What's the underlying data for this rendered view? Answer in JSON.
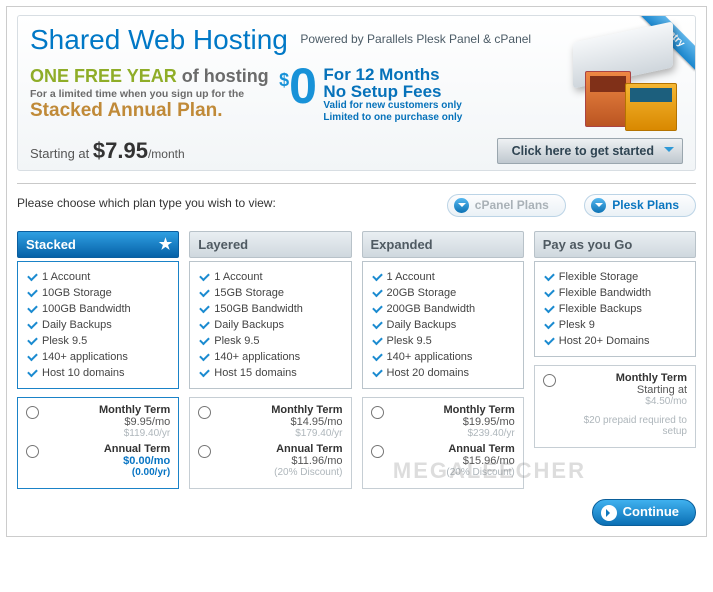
{
  "header": {
    "title": "Shared Web Hosting",
    "subtitle": "Powered by Parallels Plesk Panel & cPanel",
    "ribbon": "Entry"
  },
  "promo": {
    "line1_green": "ONE FREE YEAR",
    "line1_gray": " of hosting",
    "line2": "For a limited time when you sign up for the",
    "line3": "Stacked Annual Plan.",
    "zero_dollar": "$",
    "zero": "0",
    "r1a": "For 12 Months",
    "r1b": "No Setup Fees",
    "r2a": "Valid for new customers only",
    "r2b": "Limited to one purchase only"
  },
  "starting": {
    "label": "Starting at ",
    "price": "$7.95",
    "per": "/month"
  },
  "cta": "Click here to get started",
  "choose": "Please choose which plan type you wish to view:",
  "pills": {
    "cpanel": "cPanel Plans",
    "plesk": "Plesk Plans"
  },
  "plans": [
    {
      "name": "Stacked",
      "featured": true,
      "features": [
        "1 Account",
        "10GB Storage",
        "100GB Bandwidth",
        "Daily Backups",
        "Plesk 9.5",
        "140+ applications",
        "Host 10 domains"
      ],
      "terms": [
        {
          "label": "Monthly Term",
          "price": "$9.95/mo",
          "alt": "$119.40/yr"
        },
        {
          "label": "Annual Term",
          "price": "$0.00/mo",
          "alt": "(0.00/yr)",
          "blue": true
        }
      ]
    },
    {
      "name": "Layered",
      "features": [
        "1 Account",
        "15GB Storage",
        "150GB Bandwidth",
        "Daily Backups",
        "Plesk 9.5",
        "140+ applications",
        "Host 15 domains"
      ],
      "terms": [
        {
          "label": "Monthly Term",
          "price": "$14.95/mo",
          "alt": "$179.40/yr"
        },
        {
          "label": "Annual Term",
          "price": "$11.96/mo",
          "alt": "(20% Discount)"
        }
      ]
    },
    {
      "name": "Expanded",
      "features": [
        "1 Account",
        "20GB Storage",
        "200GB Bandwidth",
        "Daily Backups",
        "Plesk 9.5",
        "140+ applications",
        "Host 20 domains"
      ],
      "terms": [
        {
          "label": "Monthly Term",
          "price": "$19.95/mo",
          "alt": "$239.40/yr"
        },
        {
          "label": "Annual Term",
          "price": "$15.96/mo",
          "alt": "(20% Discount)"
        }
      ]
    },
    {
      "name": "Pay as you Go",
      "features": [
        "Flexible Storage",
        "Flexible Bandwidth",
        "Flexible Backups",
        "Plesk 9",
        "Host 20+ Domains"
      ],
      "terms": [
        {
          "label": "Monthly Term",
          "price": "Starting at",
          "alt": "$4.50/mo",
          "single": true,
          "extra": "$20 prepaid required to setup"
        }
      ]
    }
  ],
  "continue": "Continue",
  "watermark": "MEGALEECHER"
}
